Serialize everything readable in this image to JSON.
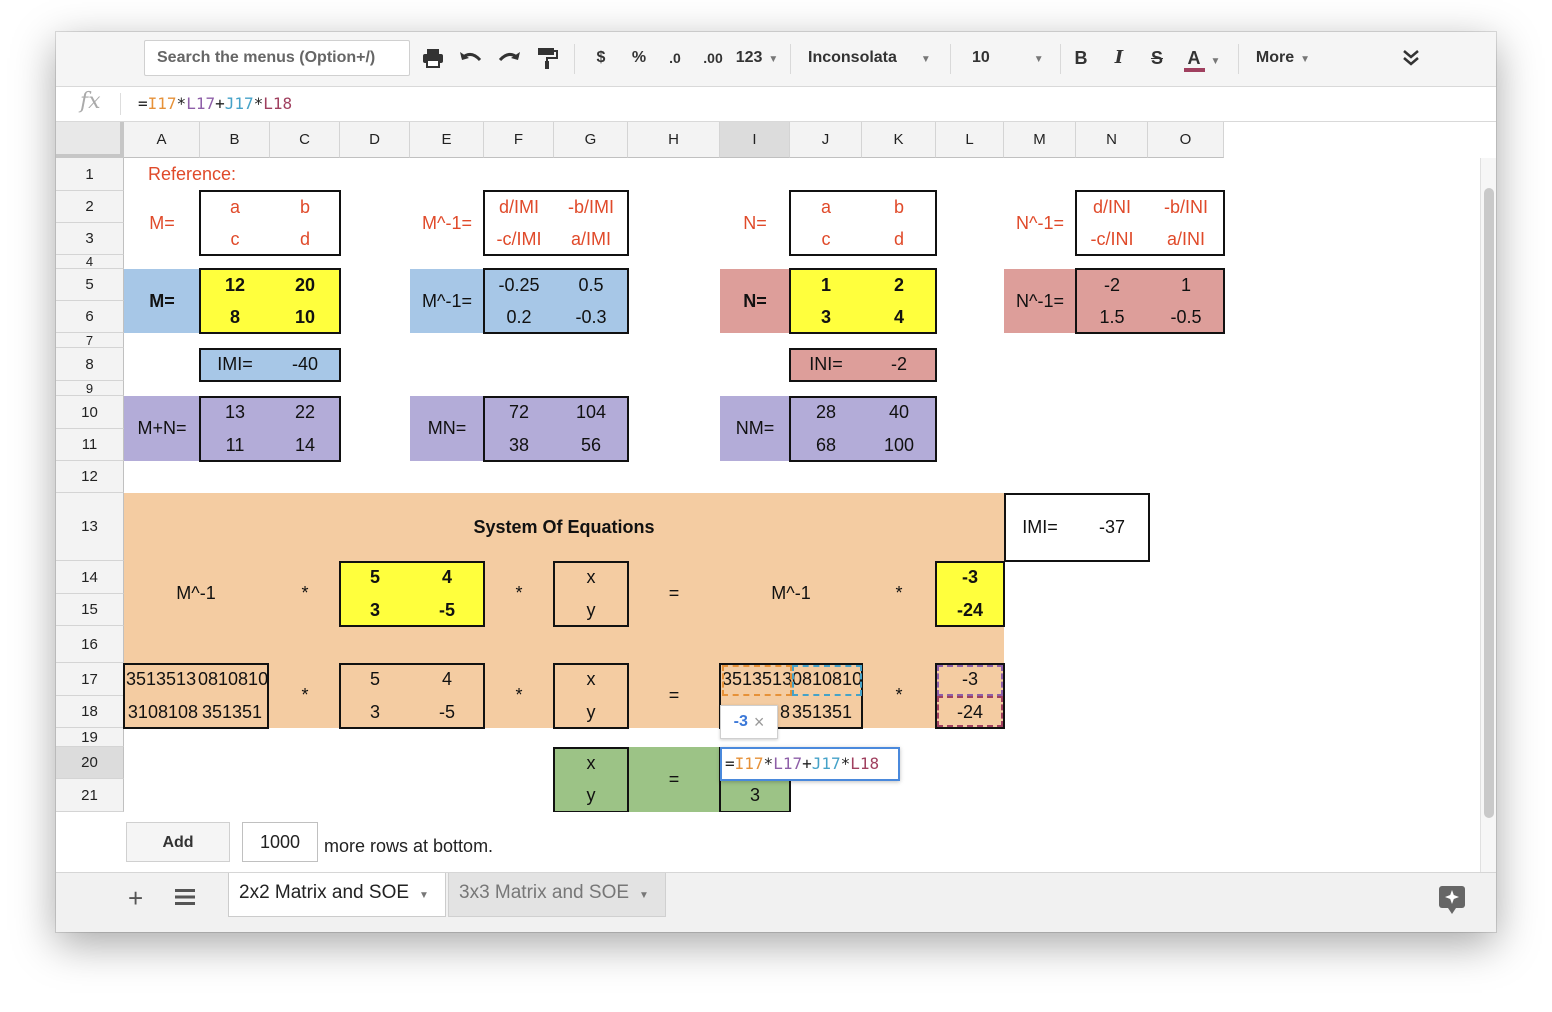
{
  "toolbar": {
    "search_placeholder": "Search the menus (Option+/)",
    "currency": "$",
    "percent": "%",
    "decrease_decimal": ".0",
    "increase_decimal": ".00",
    "number_format": "123",
    "font": "Inconsolata",
    "font_size": "10",
    "bold": "B",
    "italic": "I",
    "strike": "S",
    "text_color": "A",
    "more": "More"
  },
  "formula_bar": {
    "fx": "fx",
    "parts": [
      "=",
      "I17",
      "*",
      "L17",
      "+",
      "J17",
      "*",
      "L18"
    ]
  },
  "columns": [
    "A",
    "B",
    "C",
    "D",
    "E",
    "F",
    "G",
    "H",
    "I",
    "J",
    "K",
    "L",
    "M",
    "N",
    "O"
  ],
  "rows": [
    "1",
    "2",
    "3",
    "4",
    "5",
    "6",
    "7",
    "8",
    "9",
    "10",
    "11",
    "12",
    "13",
    "14",
    "15",
    "16",
    "17",
    "18",
    "19",
    "20",
    "21"
  ],
  "reference": {
    "title": "Reference:",
    "m_label": "M=",
    "m": [
      "a",
      "b",
      "c",
      "d"
    ],
    "minv_label": "M^-1=",
    "minv": [
      "d/IMI",
      "-b/IMI",
      "-c/IMI",
      "a/IMI"
    ],
    "n_label": "N=",
    "n": [
      "a",
      "b",
      "c",
      "d"
    ],
    "ninv_label": "N^-1=",
    "ninv": [
      "d/INI",
      "-b/INI",
      "-c/INI",
      "a/INI"
    ]
  },
  "matrices": {
    "m_label": "M=",
    "m": [
      "12",
      "20",
      "8",
      "10"
    ],
    "minv_label": "M^-1=",
    "minv": [
      "-0.25",
      "0.5",
      "0.2",
      "-0.3"
    ],
    "n_label": "N=",
    "n": [
      "1",
      "2",
      "3",
      "4"
    ],
    "ninv_label": "N^-1=",
    "ninv": [
      "-2",
      "1",
      "1.5",
      "-0.5"
    ],
    "det_m_label": "IMI=",
    "det_m": "-40",
    "det_n_label": "INI=",
    "det_n": "-2",
    "sum_label": "M+N=",
    "sum": [
      "13",
      "22",
      "11",
      "14"
    ],
    "mn_label": "MN=",
    "mn": [
      "72",
      "104",
      "38",
      "56"
    ],
    "nm_label": "NM=",
    "nm": [
      "28",
      "40",
      "68",
      "100"
    ]
  },
  "soe": {
    "title": "System Of Equations",
    "det_label": "IMI=",
    "det": "-37",
    "row14": {
      "left": "M^-1",
      "times1": "*",
      "matrix": [
        "5",
        "4",
        "3",
        "-5"
      ],
      "times2": "*",
      "vars": [
        "x",
        "y"
      ],
      "equals": "=",
      "right": "M^-1",
      "times3": "*",
      "consts": [
        "-3",
        "-24"
      ]
    },
    "row17": {
      "a17": "3513513",
      "b17": "0810810",
      "a18": "3108108",
      "b18": "351351",
      "times1": "*",
      "matrix": [
        "5",
        "4",
        "3",
        "-5"
      ],
      "times2": "*",
      "vars": [
        "x",
        "y"
      ],
      "equals": "=",
      "i17": "3513513",
      "j17": "0810810",
      "i18": "8",
      "j18": "351351",
      "times3": "*",
      "consts": [
        "-3",
        "-24"
      ]
    },
    "result": {
      "vars": [
        "x",
        "y"
      ],
      "equals": "=",
      "y_value": "3"
    }
  },
  "value_popup": {
    "value": "-3",
    "close": "×"
  },
  "add_rows": {
    "button": "Add",
    "count": "1000",
    "text": "more rows at bottom."
  },
  "tabs": [
    {
      "label": "2x2 Matrix and SOE"
    },
    {
      "label": "3x3 Matrix and SOE"
    }
  ],
  "colors": {
    "red_text": "#e04a2a",
    "blue_fill": "#a7c7e7",
    "yellow_fill": "#ffff3d",
    "rose_fill": "#dd9e9a",
    "lavender_fill": "#b3acd8",
    "peach_fill": "#f4cca2",
    "green_fill": "#9cc386"
  }
}
